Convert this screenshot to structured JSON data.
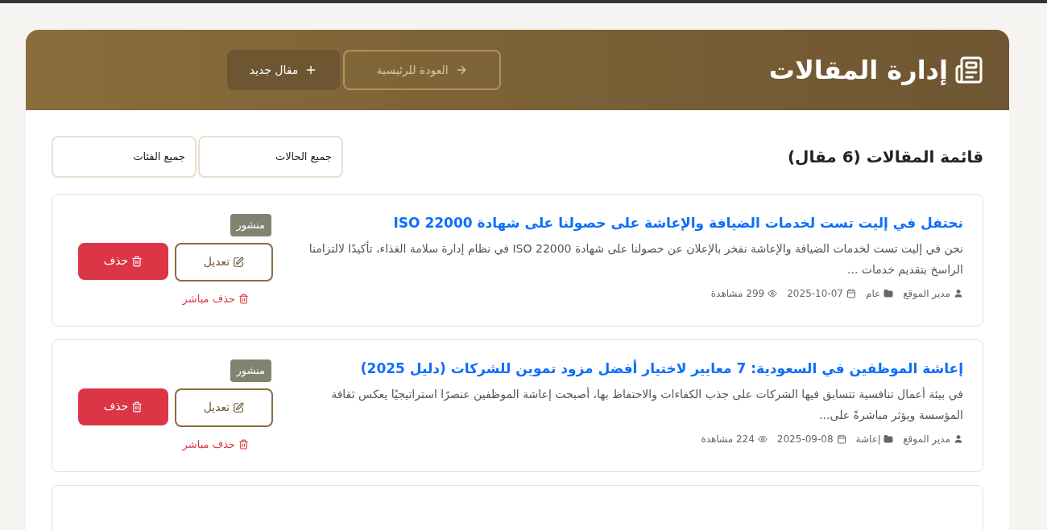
{
  "header": {
    "title": "إدارة المقالات",
    "buttons": [
      {
        "kind": "back",
        "label": "العودة للرئيسية",
        "disabled": true
      },
      {
        "kind": "new",
        "label": "مقال جديد",
        "disabled": false
      }
    ]
  },
  "list": {
    "heading": "قائمة المقالات (6 مقال)",
    "filters": [
      {
        "value": "جميع الحالات"
      },
      {
        "value": "جميع الفئات"
      }
    ]
  },
  "articles": [
    {
      "title": "نحتفل في إليت تست لخدمات الضيافة والإعاشة على حصولنا على شهادة ISO 22000",
      "excerpt": "نحن في إليت تست لخدمات الضيافة والإعاشة نفخر بالإعلان عن حصولنا على شهادة ISO 22000 في نظام إدارة سلامة الغذاء، تأكيدًا لالتزامنا الراسخ بتقديم خدمات ...",
      "author": "مدير الموقع",
      "category": "عام",
      "date": "2025-10-07",
      "views": "299 مشاهدة",
      "status": "منشور",
      "edit": "تعديل",
      "delete": "حذف",
      "direct_delete": "حذف مباشر"
    },
    {
      "title": "إعاشة الموظفين في السعودية: 7 معايير لاختيار أفضل مزود تموين للشركات (دليل 2025)",
      "excerpt": "في بيئة أعمال تنافسية تتسابق فيها الشركات على جذب الكفاءات والاحتفاظ بها، أصبحت إعاشة الموظفين عنصرًا استراتيجيًا يعكس ثقافة المؤسسة ويؤثر مباشرةً على...",
      "author": "مدير الموقع",
      "category": "إعاشة",
      "date": "2025-09-08",
      "views": "224 مشاهدة",
      "status": "منشور",
      "edit": "تعديل",
      "delete": "حذف",
      "direct_delete": "حذف مباشر"
    }
  ]
}
